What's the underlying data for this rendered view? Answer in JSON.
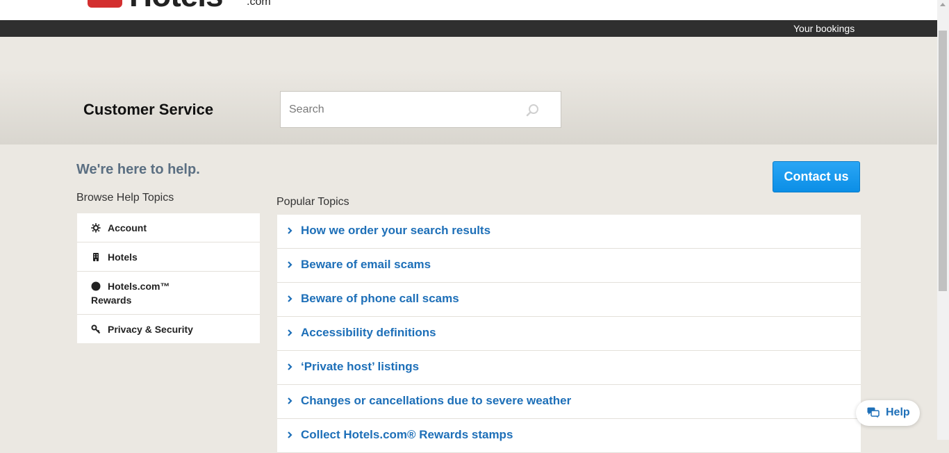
{
  "header": {
    "logo_text": "Hotels",
    "logo_suffix": ".com",
    "brand_color": "#d32f2f"
  },
  "nav": {
    "your_bookings": "Your bookings"
  },
  "hero": {
    "title": "Customer Service",
    "search_placeholder": "Search"
  },
  "help": {
    "heading": "We're here to help.",
    "browse_label": "Browse Help Topics",
    "topics": [
      {
        "label": "Account",
        "icon": "gear-icon"
      },
      {
        "label": "Hotels",
        "icon": "building-icon"
      },
      {
        "label": "Hotels.com™",
        "label_line2": "Rewards",
        "icon": "rewards-icon"
      },
      {
        "label": "Privacy & Security",
        "icon": "key-icon"
      }
    ]
  },
  "contact": {
    "label": "Contact us",
    "color": "#0b8ee6"
  },
  "popular": {
    "label": "Popular Topics",
    "items": [
      "How we order your search results",
      "Beware of email scams",
      "Beware of phone call scams",
      "Accessibility definitions",
      "‘Private host’ listings",
      "Changes or cancellations due to severe weather",
      "Collect Hotels.com® Rewards stamps"
    ],
    "link_color": "#1d6fb8"
  },
  "help_button": {
    "label": "Help",
    "icon": "chat-icon"
  }
}
